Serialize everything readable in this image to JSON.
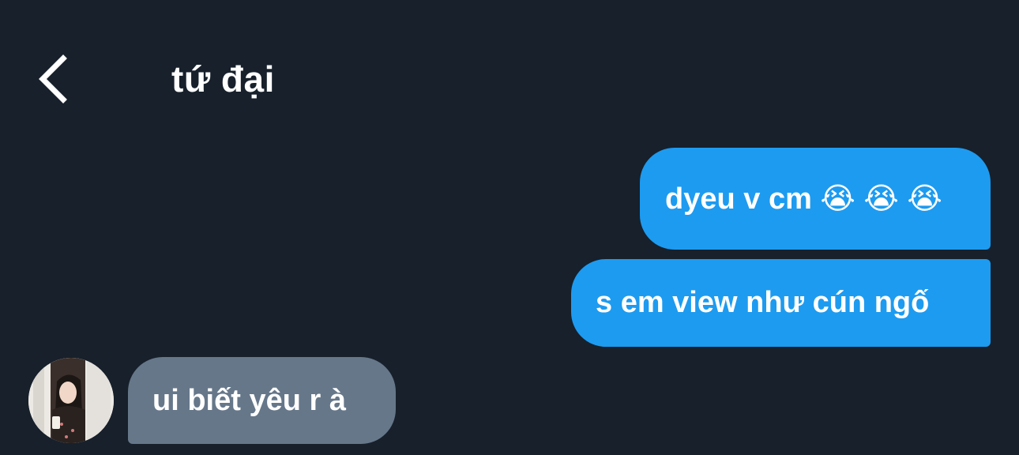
{
  "header": {
    "back_icon": "chevron-left-icon",
    "title": "tứ đại"
  },
  "messages": [
    {
      "direction": "outgoing",
      "text": "dyeu v cm 😭 😭 😭"
    },
    {
      "direction": "outgoing",
      "text": "s em view như cún ngố"
    },
    {
      "direction": "incoming",
      "text": "ui biết yêu r à"
    }
  ],
  "colors": {
    "background": "#17202b",
    "outgoing_bubble": "#1d9bf0",
    "incoming_bubble": "#66778a",
    "text": "#ffffff"
  }
}
